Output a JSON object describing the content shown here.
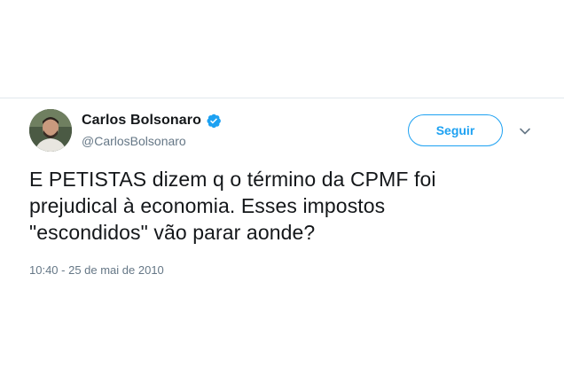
{
  "tweet": {
    "author": {
      "display_name": "Carlos Bolsonaro",
      "handle": "@CarlosBolsonaro",
      "verified": true,
      "avatar_icon": "profile-photo-icon"
    },
    "follow_label": "Seguir",
    "menu_icon": "chevron-down-icon",
    "text": "E PETISTAS dizem q o término da CPMF foi\nprejudical à economia. Esses impostos\n\"escondidos\" vão parar aonde?",
    "timestamp": "10:40 - 25 de mai de 2010"
  },
  "colors": {
    "accent": "#1da1f2",
    "secondary_text": "#657786",
    "primary_text": "#14171a"
  }
}
